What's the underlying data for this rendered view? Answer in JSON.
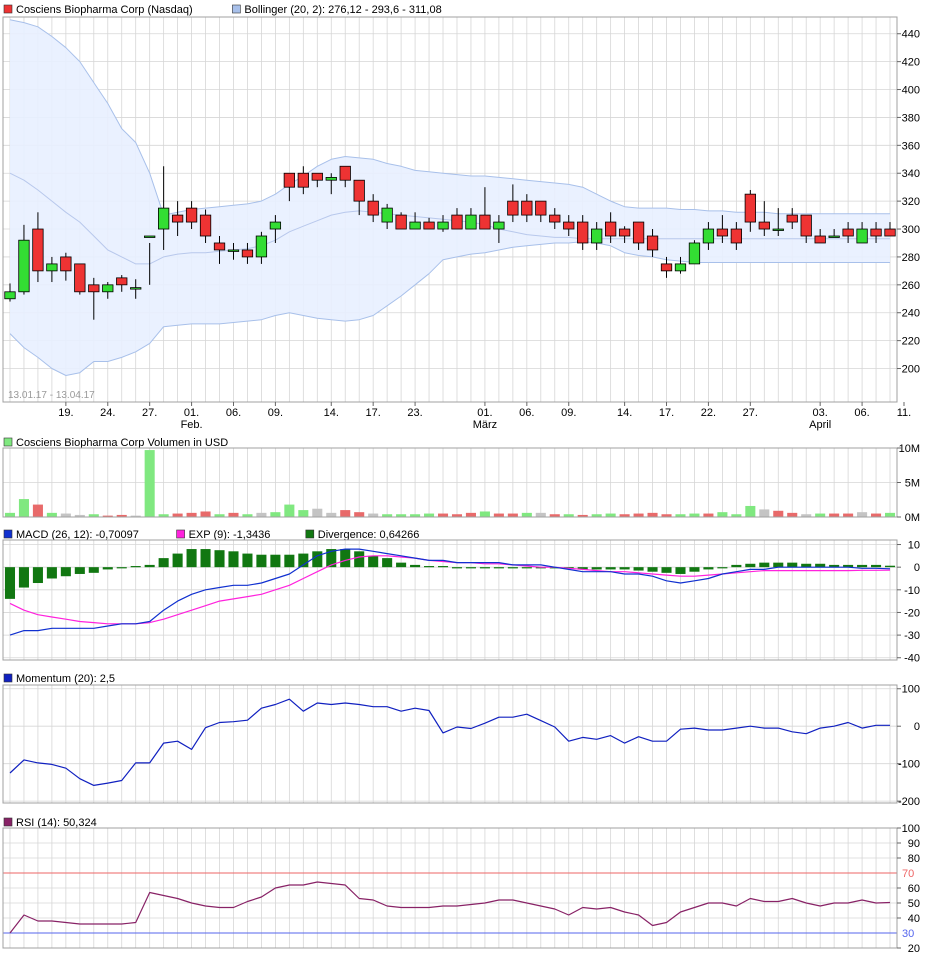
{
  "colors": {
    "up": "#33dd33",
    "down": "#ee3333",
    "band_fill": "#e8efff",
    "band_line": "#a8c0ea",
    "ma_line": "#b8c8ec",
    "grid": "#d6d6d6",
    "vol_up": "#80e880",
    "vol_down": "#e86a6a",
    "vol_neutral": "#c4c4c4",
    "macd": "#1030d0",
    "exp": "#ff22dd",
    "divergence": "#117711",
    "momentum": "#1020c0",
    "rsi": "#882266",
    "rsi_upper": "#ee6666",
    "rsi_lower": "#5566ee"
  },
  "chart_data": [
    {
      "type": "candlestick",
      "legend": [
        {
          "label": "Cosciens Biopharma Corp (Nasdaq)",
          "swatch": "#ee3333"
        },
        {
          "label": "Bollinger (20, 2): 276,12 - 293,6 - 311,08",
          "swatch": "#a8c0ea"
        }
      ],
      "date_range": "13.01.17 - 13.04.17",
      "x_ticks": [
        "19.",
        "24.",
        "27.",
        "01.",
        "06.",
        "09.",
        "14.",
        "17.",
        "23.",
        "01.",
        "06.",
        "09.",
        "14.",
        "17.",
        "22.",
        "27.",
        "03.",
        "06.",
        "11."
      ],
      "x_tick_index": [
        4,
        7,
        10,
        13,
        16,
        19,
        23,
        26,
        29,
        34,
        37,
        40,
        44,
        47,
        50,
        53,
        58,
        61,
        64
      ],
      "month_labels": [
        {
          "label": "Feb.",
          "index": 13
        },
        {
          "label": "März",
          "index": 34
        },
        {
          "label": "April",
          "index": 58
        }
      ],
      "y_ticks": [
        200,
        220,
        240,
        260,
        280,
        300,
        320,
        340,
        360,
        380,
        400,
        420,
        440
      ],
      "ylim": [
        176,
        452
      ],
      "candles": [
        [
          250,
          255,
          248,
          261
        ],
        [
          255,
          292,
          253,
          303
        ],
        [
          300,
          270,
          262,
          312
        ],
        [
          270,
          275,
          262,
          280
        ],
        [
          280,
          270,
          263,
          283
        ],
        [
          275,
          255,
          253,
          275
        ],
        [
          260,
          255,
          235,
          265
        ],
        [
          255,
          260,
          250,
          262
        ],
        [
          265,
          260,
          255,
          267
        ],
        [
          258,
          258,
          250,
          264
        ],
        [
          295,
          295,
          260,
          290
        ],
        [
          300,
          315,
          285,
          345
        ],
        [
          310,
          305,
          295,
          320
        ],
        [
          315,
          305,
          300,
          320
        ],
        [
          310,
          295,
          290,
          314
        ],
        [
          290,
          285,
          275,
          295
        ],
        [
          285,
          285,
          278,
          290
        ],
        [
          285,
          280,
          275,
          290
        ],
        [
          280,
          295,
          275,
          298
        ],
        [
          300,
          305,
          290,
          310
        ],
        [
          340,
          330,
          320,
          340
        ],
        [
          340,
          330,
          325,
          345
        ],
        [
          340,
          335,
          330,
          340
        ],
        [
          335,
          337,
          325,
          340
        ],
        [
          345,
          335,
          330,
          345
        ],
        [
          335,
          320,
          310,
          335
        ],
        [
          320,
          310,
          305,
          325
        ],
        [
          305,
          315,
          300,
          318
        ],
        [
          310,
          300,
          300,
          312
        ],
        [
          300,
          305,
          300,
          312
        ],
        [
          305,
          300,
          300,
          308
        ],
        [
          300,
          305,
          298,
          310
        ],
        [
          310,
          300,
          300,
          315
        ],
        [
          300,
          310,
          300,
          315
        ],
        [
          310,
          300,
          300,
          330
        ],
        [
          300,
          305,
          290,
          310
        ],
        [
          320,
          310,
          305,
          332
        ],
        [
          320,
          310,
          305,
          325
        ],
        [
          320,
          310,
          305,
          320
        ],
        [
          310,
          305,
          300,
          315
        ],
        [
          305,
          300,
          295,
          310
        ],
        [
          305,
          290,
          285,
          310
        ],
        [
          290,
          300,
          285,
          305
        ],
        [
          305,
          295,
          290,
          312
        ],
        [
          300,
          295,
          290,
          302
        ],
        [
          305,
          290,
          285,
          305
        ],
        [
          295,
          285,
          280,
          300
        ],
        [
          275,
          270,
          265,
          280
        ],
        [
          270,
          275,
          268,
          280
        ],
        [
          275,
          290,
          275,
          292
        ],
        [
          290,
          300,
          285,
          305
        ],
        [
          300,
          295,
          290,
          310
        ],
        [
          300,
          290,
          285,
          305
        ],
        [
          325,
          305,
          298,
          328
        ],
        [
          305,
          300,
          295,
          320
        ],
        [
          300,
          300,
          295,
          315
        ],
        [
          310,
          305,
          300,
          315
        ],
        [
          310,
          295,
          290,
          310
        ],
        [
          295,
          290,
          290,
          300
        ],
        [
          295,
          295,
          295,
          300
        ],
        [
          300,
          295,
          290,
          305
        ],
        [
          290,
          300,
          290,
          305
        ],
        [
          300,
          295,
          290,
          305
        ],
        [
          300,
          295,
          295,
          305
        ]
      ],
      "bollinger_upper": [
        450,
        448,
        445,
        438,
        430,
        420,
        405,
        390,
        372,
        362,
        340,
        310,
        312,
        314,
        315,
        316,
        317,
        318,
        320,
        325,
        332,
        338,
        345,
        350,
        352,
        351,
        350,
        347,
        345,
        342,
        341,
        340,
        339,
        338,
        338,
        337,
        336,
        335,
        334,
        333,
        332,
        330,
        325,
        320,
        316,
        315,
        315,
        315,
        314,
        314,
        313,
        313,
        312,
        312,
        312,
        311,
        311,
        311,
        311,
        311,
        311,
        311,
        311,
        311
      ],
      "bollinger_mid": [
        340,
        335,
        328,
        320,
        312,
        305,
        295,
        285,
        280,
        275,
        275,
        280,
        282,
        283,
        283,
        284,
        285,
        286,
        288,
        292,
        298,
        302,
        306,
        310,
        312,
        313,
        312,
        311,
        310,
        309,
        308,
        307,
        306,
        305,
        303,
        300,
        298,
        296,
        295,
        294,
        294,
        293,
        293,
        293,
        293,
        293,
        293,
        293,
        293,
        293,
        293,
        293,
        293,
        293,
        293,
        293,
        293,
        293,
        293,
        293,
        293,
        293,
        293,
        293
      ],
      "bollinger_lower": [
        225,
        215,
        208,
        200,
        195,
        197,
        205,
        205,
        208,
        212,
        218,
        230,
        231,
        232,
        232,
        232,
        233,
        234,
        235,
        238,
        240,
        238,
        236,
        235,
        234,
        235,
        238,
        245,
        252,
        260,
        268,
        278,
        280,
        282,
        283,
        285,
        287,
        288,
        289,
        290,
        290,
        291,
        290,
        288,
        283,
        281,
        280,
        278,
        277,
        276,
        276,
        276,
        276,
        276,
        276,
        276,
        276,
        276,
        276,
        276,
        276,
        276,
        276,
        276
      ]
    },
    {
      "type": "bar",
      "legend": [
        {
          "label": "Cosciens Biopharma Corp Volumen in USD",
          "swatch": "#80e880"
        }
      ],
      "y_ticks": [
        {
          "value": 0,
          "label": "0M"
        },
        {
          "value": 5000000,
          "label": "5M"
        },
        {
          "value": 10000000,
          "label": "10M"
        }
      ],
      "ylim": [
        0,
        10000000
      ],
      "values": [
        600000,
        2600000,
        1800000,
        600000,
        500000,
        300000,
        400000,
        200000,
        300000,
        200000,
        9700000,
        400000,
        500000,
        600000,
        800000,
        400000,
        600000,
        400000,
        600000,
        700000,
        1800000,
        1000000,
        1200000,
        600000,
        1000000,
        700000,
        500000,
        400000,
        400000,
        400000,
        500000,
        500000,
        400000,
        600000,
        800000,
        500000,
        500000,
        600000,
        600000,
        400000,
        400000,
        300000,
        400000,
        500000,
        400000,
        500000,
        600000,
        400000,
        400000,
        500000,
        500000,
        700000,
        400000,
        1600000,
        1100000,
        900000,
        600000,
        400000,
        500000,
        500000,
        500000,
        700000,
        500000,
        600000
      ],
      "value_types": [
        "up",
        "up",
        "down",
        "up",
        "neutral",
        "neutral",
        "up",
        "down",
        "down",
        "neutral",
        "up",
        "up",
        "down",
        "down",
        "down",
        "up",
        "down",
        "up",
        "neutral",
        "up",
        "up",
        "up",
        "neutral",
        "neutral",
        "down",
        "down",
        "neutral",
        "up",
        "up",
        "up",
        "up",
        "down",
        "down",
        "down",
        "up",
        "down",
        "down",
        "up",
        "neutral",
        "down",
        "up",
        "down",
        "up",
        "up",
        "down",
        "down",
        "down",
        "down",
        "up",
        "up",
        "down",
        "up",
        "up",
        "up",
        "neutral",
        "down",
        "down",
        "neutral",
        "up",
        "down",
        "down",
        "neutral",
        "down",
        "up"
      ]
    },
    {
      "type": "line",
      "legend": [
        {
          "label": "MACD (26, 12): -0,70097",
          "swatch": "#1030d0"
        },
        {
          "label": "EXP (9): -1,3436",
          "swatch": "#ff22dd"
        },
        {
          "label": "Divergence: 0,64266",
          "swatch": "#117711"
        }
      ],
      "y_ticks": [
        -40,
        -30,
        -20,
        -10,
        0,
        10
      ],
      "ylim": [
        -41,
        12
      ],
      "series": [
        {
          "name": "MACD",
          "values": [
            -30,
            -28,
            -28,
            -27,
            -27,
            -27,
            -27,
            -26,
            -25,
            -25,
            -24,
            -19,
            -15,
            -12,
            -10,
            -9,
            -8,
            -8,
            -7,
            -5,
            -3,
            1,
            5,
            7,
            8,
            8,
            7,
            6,
            5,
            4,
            3,
            3,
            2,
            2,
            2,
            2,
            1,
            1,
            1,
            0,
            -1,
            -2,
            -2,
            -2,
            -3,
            -3,
            -4,
            -6,
            -7,
            -6,
            -5,
            -3,
            -2,
            -1,
            -1,
            0,
            0,
            0,
            0,
            0,
            0,
            -0.5,
            -0.5,
            -0.7
          ]
        },
        {
          "name": "EXP",
          "values": [
            -16,
            -19,
            -21,
            -22,
            -23,
            -24,
            -24.5,
            -25,
            -25,
            -25,
            -24.5,
            -23,
            -21,
            -19,
            -17,
            -15,
            -14,
            -13,
            -12,
            -10,
            -8,
            -5,
            -2,
            1,
            3,
            4.5,
            5,
            5,
            4.5,
            4,
            3,
            2.5,
            2,
            2,
            1.5,
            1.5,
            1,
            0.5,
            0,
            0,
            -0.5,
            -1,
            -1.5,
            -2,
            -2,
            -2.5,
            -3,
            -3.5,
            -4,
            -4,
            -3.5,
            -3,
            -2.5,
            -2,
            -1.5,
            -1.5,
            -1.5,
            -1.5,
            -1.5,
            -1.5,
            -1.5,
            -1.4,
            -1.4,
            -1.3436
          ]
        },
        {
          "name": "Divergence",
          "values": [
            -14,
            -9,
            -7,
            -5,
            -4,
            -3,
            -2.5,
            -1,
            0,
            0.5,
            1,
            4,
            6,
            8,
            8,
            7.5,
            7,
            6,
            5.5,
            5.5,
            5.5,
            6,
            7,
            8,
            8,
            7,
            5,
            4,
            2,
            1,
            0.5,
            0.5,
            0,
            0,
            -0.5,
            -0.5,
            -0.5,
            0,
            0,
            -0.5,
            -0.5,
            -1,
            -1,
            -1,
            -1,
            -1.5,
            -2,
            -2.5,
            -3,
            -2,
            -1,
            0,
            1,
            1.5,
            2,
            2,
            2,
            1.5,
            1.5,
            1,
            1,
            1,
            1,
            0.64266
          ]
        }
      ]
    },
    {
      "type": "line",
      "legend": [
        {
          "label": "Momentum (20): 2,5",
          "swatch": "#1020c0"
        }
      ],
      "y_ticks": [
        -200,
        -100,
        0,
        100
      ],
      "ylim": [
        -205,
        110
      ],
      "series": [
        {
          "name": "Momentum",
          "values": [
            -125,
            -90,
            -98,
            -102,
            -112,
            -140,
            -158,
            -152,
            -145,
            -98,
            -98,
            -45,
            -40,
            -62,
            -4,
            10,
            12,
            16,
            48,
            58,
            72,
            40,
            62,
            58,
            62,
            58,
            52,
            52,
            40,
            48,
            42,
            -18,
            -2,
            -6,
            8,
            24,
            24,
            32,
            15,
            -2,
            -40,
            -30,
            -35,
            -25,
            -45,
            -28,
            -40,
            -40,
            -8,
            -5,
            -10,
            -10,
            -5,
            0,
            -5,
            -5,
            -15,
            -20,
            -5,
            0,
            10,
            -5,
            2.5,
            2.5
          ]
        }
      ]
    },
    {
      "type": "line",
      "legend": [
        {
          "label": "RSI (14): 50,324",
          "swatch": "#882266"
        }
      ],
      "y_ticks": [
        20,
        30,
        40,
        50,
        60,
        70,
        80,
        90,
        100
      ],
      "ylim": [
        20,
        100
      ],
      "bands": [
        {
          "value": 70,
          "label": "70"
        },
        {
          "value": 30,
          "label": "30"
        }
      ],
      "series": [
        {
          "name": "RSI",
          "values": [
            30,
            42,
            38,
            38,
            37,
            36,
            36,
            36,
            36,
            37,
            57,
            55,
            53,
            50,
            48,
            47,
            47,
            51,
            54,
            60,
            62,
            62,
            64,
            63,
            62,
            53,
            52,
            48,
            47,
            47,
            47,
            48,
            48,
            49,
            50,
            52,
            52,
            50,
            48,
            46,
            42,
            47,
            46,
            47,
            44,
            42,
            35,
            37,
            44,
            47,
            50,
            50,
            48,
            53,
            51,
            51,
            53,
            50,
            48,
            50,
            50,
            52,
            50,
            50.324
          ]
        }
      ]
    }
  ]
}
